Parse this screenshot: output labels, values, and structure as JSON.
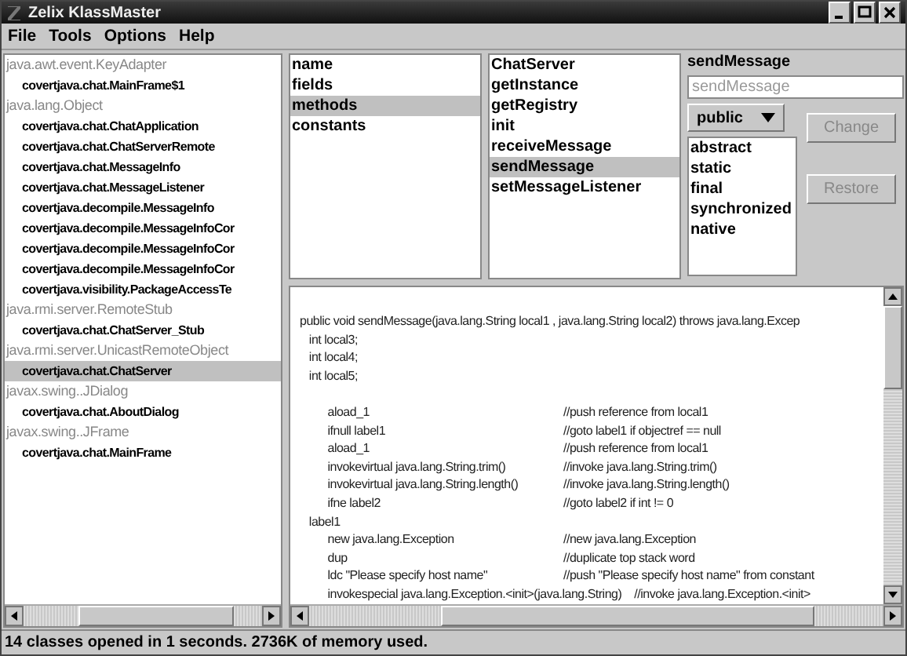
{
  "window": {
    "title": "Zelix KlassMaster"
  },
  "menu": [
    "File",
    "Tools",
    "Options",
    "Help"
  ],
  "class_tree": [
    {
      "label": "java.awt.event.KeyAdapter",
      "children": [
        {
          "label": "covertjava.chat.MainFrame$1",
          "selected": false
        }
      ]
    },
    {
      "label": "java.lang.Object",
      "children": [
        {
          "label": "covertjava.chat.ChatApplication",
          "selected": false
        },
        {
          "label": "covertjava.chat.ChatServerRemote",
          "selected": false
        },
        {
          "label": "covertjava.chat.MessageInfo",
          "selected": false
        },
        {
          "label": "covertjava.chat.MessageListener",
          "selected": false
        },
        {
          "label": "covertjava.decompile.MessageInfo",
          "selected": false
        },
        {
          "label": "covertjava.decompile.MessageInfoCor",
          "selected": false
        },
        {
          "label": "covertjava.decompile.MessageInfoCor",
          "selected": false
        },
        {
          "label": "covertjava.decompile.MessageInfoCor",
          "selected": false
        },
        {
          "label": "covertjava.visibility.PackageAccessTe",
          "selected": false
        }
      ]
    },
    {
      "label": "java.rmi.server.RemoteStub",
      "children": [
        {
          "label": "covertjava.chat.ChatServer_Stub",
          "selected": false
        }
      ]
    },
    {
      "label": "java.rmi.server.UnicastRemoteObject",
      "children": [
        {
          "label": "covertjava.chat.ChatServer",
          "selected": true
        }
      ]
    },
    {
      "label": "javax.swing..JDialog",
      "children": [
        {
          "label": "covertjava.chat.AboutDialog",
          "selected": false
        }
      ]
    },
    {
      "label": "javax.swing..JFrame",
      "children": [
        {
          "label": "covertjava.chat.MainFrame",
          "selected": false
        }
      ]
    }
  ],
  "categories": [
    {
      "label": "name",
      "selected": false
    },
    {
      "label": "fields",
      "selected": false
    },
    {
      "label": "methods",
      "selected": true
    },
    {
      "label": "constants",
      "selected": false
    }
  ],
  "members": [
    {
      "label": "ChatServer",
      "selected": false
    },
    {
      "label": "getInstance",
      "selected": false
    },
    {
      "label": "getRegistry",
      "selected": false
    },
    {
      "label": "init",
      "selected": false
    },
    {
      "label": "receiveMessage",
      "selected": false
    },
    {
      "label": "sendMessage",
      "selected": true
    },
    {
      "label": "setMessageListener",
      "selected": false
    }
  ],
  "editor": {
    "title": "sendMessage",
    "name_field": {
      "value": "sendMessage",
      "disabled": true
    },
    "access": "public",
    "modifiers": [
      "abstract",
      "static",
      "final",
      "synchronized",
      "native"
    ],
    "buttons": [
      {
        "label": "Change",
        "disabled": true
      },
      {
        "label": "Restore",
        "disabled": true
      }
    ]
  },
  "code": [
    {
      "code": "public void sendMessage(java.lang.String local1 , java.lang.String local2) throws java.lang.Excep"
    },
    {
      "code": "   int local3;"
    },
    {
      "code": "   int local4;"
    },
    {
      "code": "   int local5;"
    },
    {
      "code": "         aload_1",
      "comment": "//push reference from local1",
      "gap_before": true
    },
    {
      "code": "         ifnull label1",
      "comment": "//goto label1 if objectref == null"
    },
    {
      "code": "         aload_1",
      "comment": "//push reference from local1"
    },
    {
      "code": "         invokevirtual java.lang.String.trim()",
      "comment": "//invoke java.lang.String.trim()"
    },
    {
      "code": "         invokevirtual java.lang.String.length()",
      "comment": "//invoke java.lang.String.length()"
    },
    {
      "code": "         ifne label2",
      "comment": "//goto label2 if int != 0"
    },
    {
      "code": "   label1"
    },
    {
      "code": "         new java.lang.Exception",
      "comment": "//new java.lang.Exception"
    },
    {
      "code": "         dup",
      "comment": "//duplicate top stack word"
    },
    {
      "code": "         ldc \"Please specify host name\"",
      "comment": "//push \"Please specify host name\" from constant"
    },
    {
      "code": "         invokespecial java.lang.Exception.<init>(java.lang.String)",
      "comment": "//invoke java.lang.Exception.<init>"
    }
  ],
  "status_bar": "14 classes opened in 1 seconds. 2736K of memory used."
}
